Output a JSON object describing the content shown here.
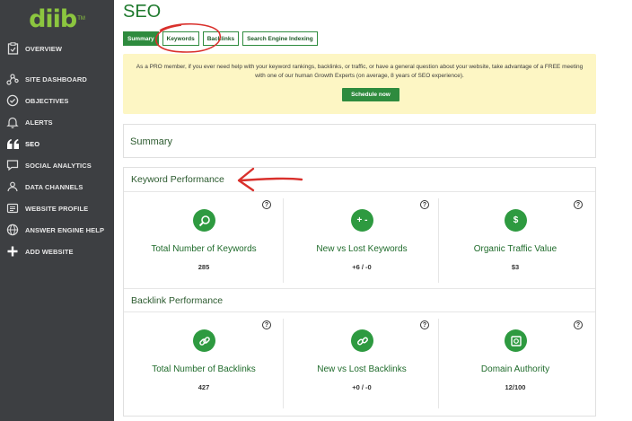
{
  "app": {
    "logo": "diib",
    "logo_tm": "TM"
  },
  "sidebar": {
    "items": [
      {
        "label": "OVERVIEW",
        "icon": "clipboard-icon"
      },
      {
        "label": "SITE DASHBOARD",
        "icon": "network-icon"
      },
      {
        "label": "OBJECTIVES",
        "icon": "check-circle-icon"
      },
      {
        "label": "ALERTS",
        "icon": "bell-icon"
      },
      {
        "label": "SEO",
        "icon": "quote-icon",
        "active": true
      },
      {
        "label": "SOCIAL ANALYTICS",
        "icon": "chat-icon"
      },
      {
        "label": "DATA CHANNELS",
        "icon": "channels-icon"
      },
      {
        "label": "WEBSITE PROFILE",
        "icon": "profile-card-icon"
      },
      {
        "label": "ANSWER ENGINE HELP",
        "icon": "globe-icon"
      },
      {
        "label": "ADD WEBSITE",
        "icon": "plus-icon"
      }
    ]
  },
  "page": {
    "title": "SEO"
  },
  "tabs": [
    {
      "label": "Summary",
      "active": true
    },
    {
      "label": "Keywords"
    },
    {
      "label": "Backlinks"
    },
    {
      "label": "Search Engine Indexing"
    }
  ],
  "promo": {
    "text": "As a PRO member, if you ever need help with your keyword rankings, backlinks, or traffic, or have a general question about your website, take advantage of a FREE meeting with one of our human Growth Experts (on average, 8 years of SEO experience).",
    "button": "Schedule now"
  },
  "summary": {
    "title": "Summary"
  },
  "keyword_performance": {
    "title": "Keyword Performance",
    "metrics": [
      {
        "label": "Total Number of Keywords",
        "value": "285",
        "icon": "magnifier-icon"
      },
      {
        "label": "New vs Lost Keywords",
        "value": "+6 / -0",
        "icon": "plus-minus-icon",
        "icon_text": "+ -"
      },
      {
        "label": "Organic Traffic Value",
        "value": "$3",
        "icon": "dollar-icon",
        "icon_text": "$"
      }
    ]
  },
  "backlink_performance": {
    "title": "Backlink Performance",
    "metrics": [
      {
        "label": "Total Number of Backlinks",
        "value": "427",
        "icon": "link-icon"
      },
      {
        "label": "New vs Lost Backlinks",
        "value": "+0 / -0",
        "icon": "broken-link-icon"
      },
      {
        "label": "Domain Authority",
        "value": "12/100",
        "icon": "certificate-icon"
      }
    ]
  },
  "help_glyph": "?",
  "colors": {
    "accent_green": "#2e8b3e",
    "sidebar_bg": "#3d3f42",
    "promo_bg": "#fdf6c4",
    "annotation_red": "#d9302c"
  }
}
